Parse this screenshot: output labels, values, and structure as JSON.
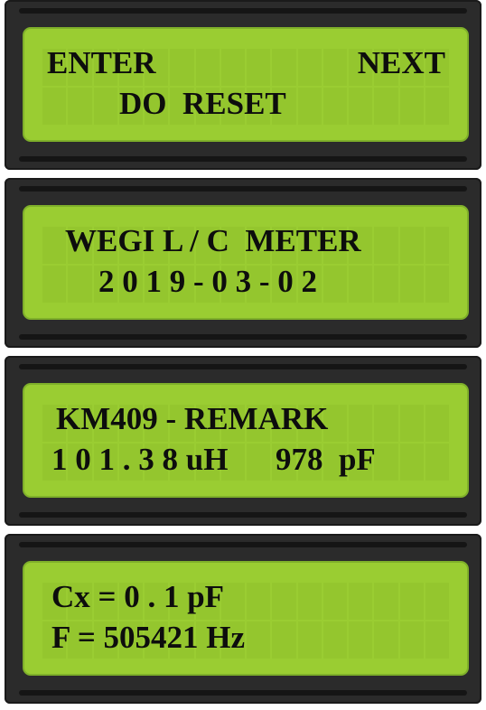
{
  "displays": [
    {
      "line1": "ENTER",
      "line1_right": "NEXT",
      "line2": "DO  RESET"
    },
    {
      "line1": "WEGI L / C  METER",
      "line2": "2 0 1 9 - 0 3 - 0 2"
    },
    {
      "line1": "KM409 - REMARK",
      "line2": "1 0 1 . 3 8 uH      978  pF"
    },
    {
      "line1": "Cx = 0 . 1 pF",
      "line2": "F = 505421 Hz"
    }
  ]
}
